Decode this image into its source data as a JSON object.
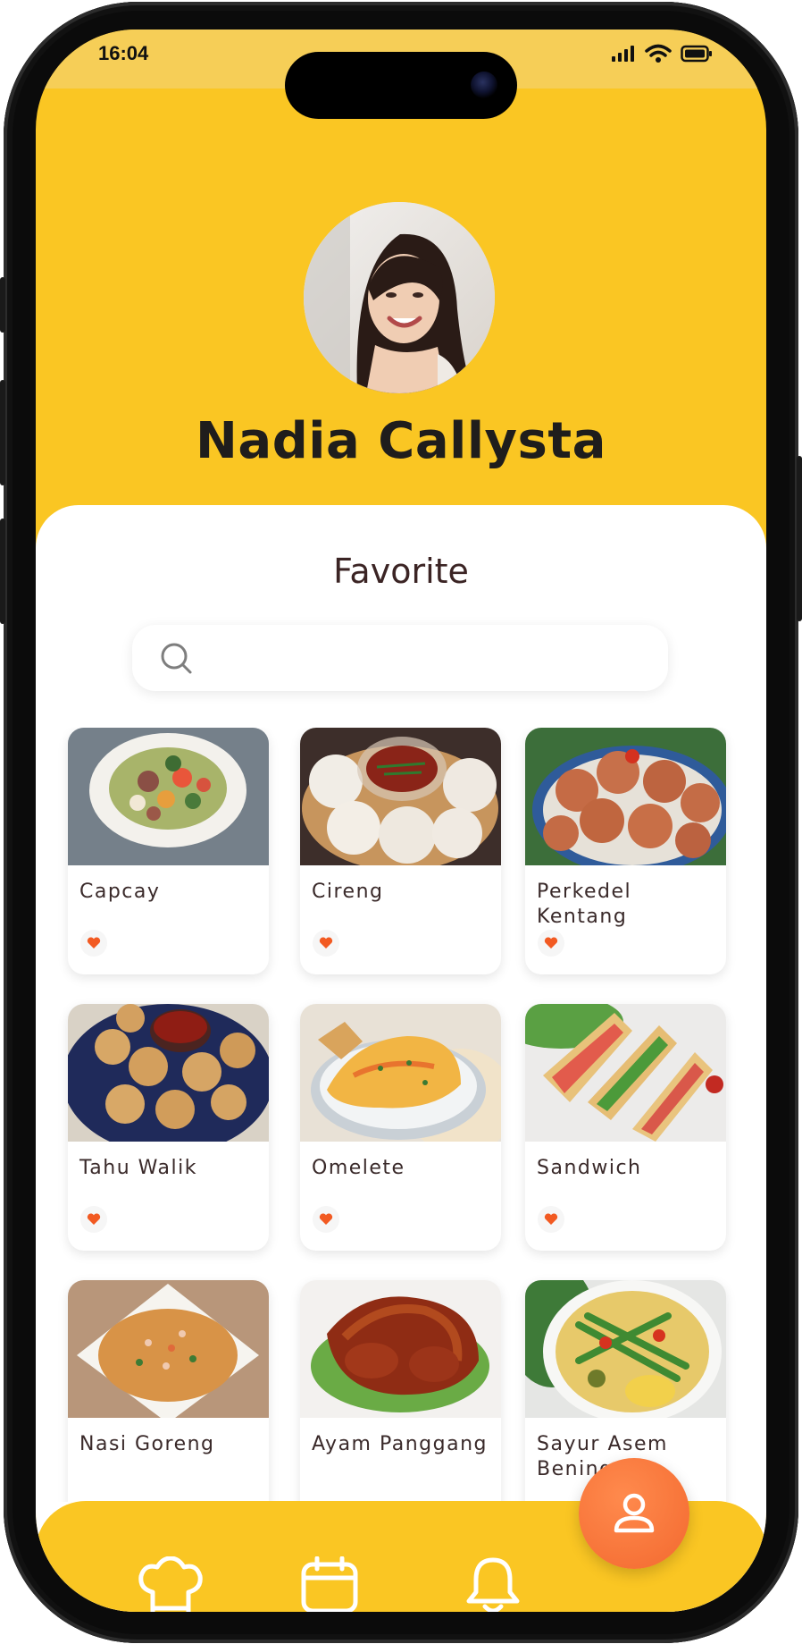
{
  "status_bar": {
    "time": "16:04"
  },
  "profile": {
    "name": "Nadia Callysta"
  },
  "favorites": {
    "title": "Favorite",
    "search": {
      "placeholder": "",
      "value": ""
    },
    "items": [
      {
        "name": "Capcay"
      },
      {
        "name": "Cireng"
      },
      {
        "name": "Perkedel Kentang"
      },
      {
        "name": "Tahu Walik"
      },
      {
        "name": "Omelete"
      },
      {
        "name": "Sandwich"
      },
      {
        "name": "Nasi Goreng"
      },
      {
        "name": "Ayam Panggang"
      },
      {
        "name": "Sayur Asem Bening"
      }
    ]
  },
  "nav": {
    "items": [
      {
        "icon": "chef-hat-icon"
      },
      {
        "icon": "calendar-icon"
      },
      {
        "icon": "bell-icon"
      },
      {
        "icon": "user-icon",
        "active": true
      }
    ]
  },
  "colors": {
    "accent": "#fac623",
    "fab": "#f3692f",
    "heart": "#f25a22",
    "title": "#3b2424"
  }
}
